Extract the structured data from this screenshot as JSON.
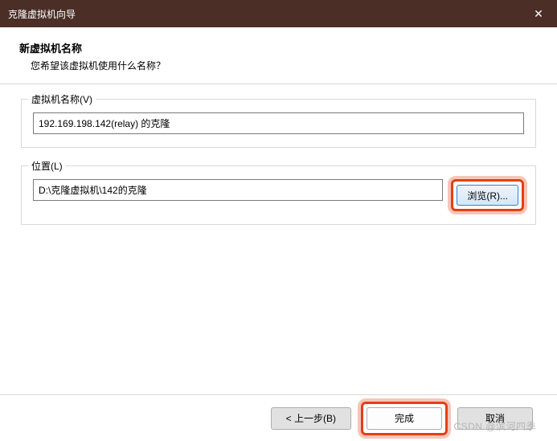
{
  "titlebar": {
    "title": "克隆虚拟机向导",
    "close_icon": "✕"
  },
  "header": {
    "title": "新虚拟机名称",
    "subtitle": "您希望该虚拟机使用什么名称？"
  },
  "group_name": {
    "label": "虚拟机名称(V)",
    "value": "192.169.198.142(relay) 的克隆"
  },
  "group_location": {
    "label": "位置(L)",
    "value": "D:\\克隆虚拟机\\142的克隆",
    "browse_label": "浏览(R)..."
  },
  "footer": {
    "back_label": "< 上一步(B)",
    "finish_label": "完成",
    "cancel_label": "取消"
  },
  "watermark": "CSDN @滨河四季"
}
